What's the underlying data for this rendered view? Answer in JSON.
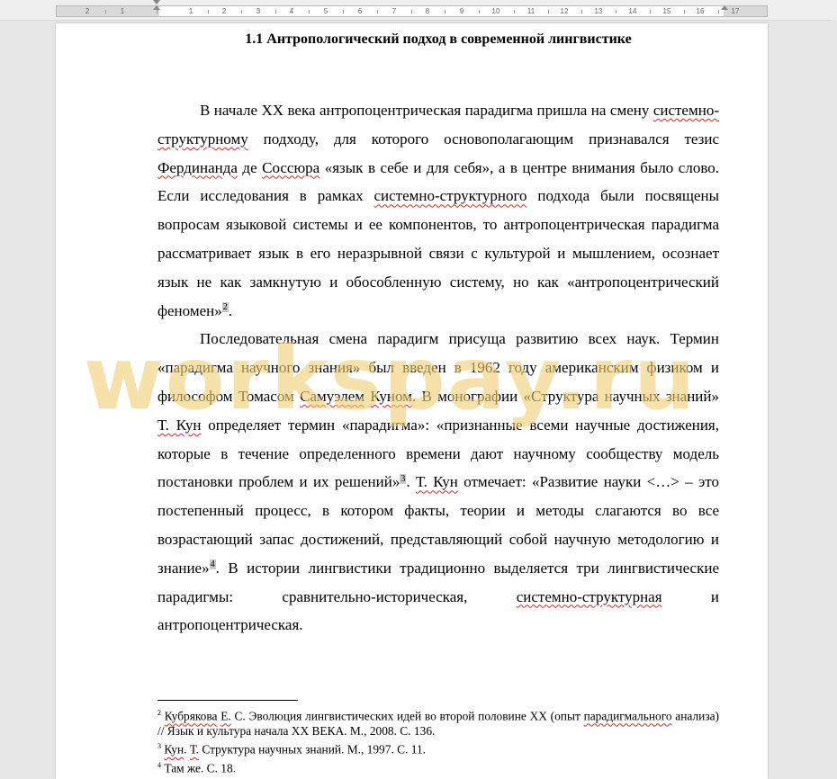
{
  "ruler": {
    "labels": [
      "2",
      "1",
      "1",
      "2",
      "3",
      "4",
      "5",
      "6",
      "7",
      "8",
      "9",
      "10",
      "11",
      "12",
      "13",
      "14",
      "15",
      "16",
      "17"
    ]
  },
  "document": {
    "heading": "1.1 Антропологический подход в современной лингвистике",
    "paragraph1": {
      "t1": "В начале XX века антропоцентрическая парадигма пришла на смену ",
      "s1": "системно-структурному",
      "t2": " подходу, для которого основополагающим признавался тезис ",
      "s2": "Фердинанда",
      "t3": " де ",
      "s3": "Соссюра",
      "t4": " «язык в себе и для себя», а в центре внимания было слово. Если исследования в рамках ",
      "s4": "системно-структурного",
      "t5": " подхода были посвящены вопросам языковой системы и ее компонентов, то антропоцентрическая парадигма рассматривает язык в его неразрывной связи с культурой и мышлением, осознает язык не как замкнутую и обособленную систему, но как «антропоцентрический феномен»",
      "ref": "2",
      "t6": "."
    },
    "paragraph2": {
      "t1": "Последовательная смена парадигм присуща развитию всех наук. Термин «парадигма научного знания» был введен в 1962 году американским физиком и философом Томасом ",
      "s1": "Самуэлем",
      "t2": " ",
      "s2": "Куном",
      "t3": ". В монографии «Структура научных знаний» ",
      "s3": "Т. Кун",
      "t4": " определяет термин «парадигма»: «признанные всеми научные достижения, которые в течение определенного времени дают научному сообществу модель постановки проблем и их решений»",
      "ref1": "3",
      "t5": ". ",
      "s4": "Т. Кун",
      "t6": " отмечает: «Развитие науки <…> – это постепенный процесс, в котором факты, теории и методы слагаются во все возрастающий запас достижений, представляющий собой научную методологию и знание»",
      "ref2": "4",
      "t7": ". В истории лингвистики традиционно выделяется три лингвистические парадигмы: сравнительно-историческая, ",
      "s5": "системно-структурная",
      "t8": " и антропоцентрическая."
    },
    "footnotes": [
      {
        "num": "2",
        "sq1": "Кубрякова",
        "t1": " ",
        "sq2": "Е.",
        "t2": " С. Эволюция лингвистических идей во второй половине XX (опыт ",
        "sq3": "парадигмального",
        "t3": " анализа) // Язык и культура начала XX ВЕКА.  М., 2008. С. 136."
      },
      {
        "num": "3",
        "sq1": "Кун",
        "t1": ". ",
        "sq2": "Т.",
        "t2": " Структура научных знаний. М., 1997. С. 11."
      },
      {
        "num": "4",
        "t1": "Там же. С. 18."
      }
    ]
  },
  "watermark": {
    "text": "workspay.ru"
  }
}
